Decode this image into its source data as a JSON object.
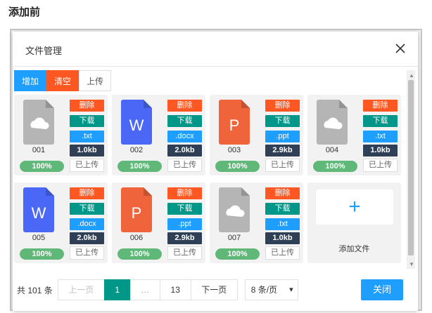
{
  "page_heading": "添加前",
  "dialog": {
    "title": "文件管理",
    "close_icon": "close-icon"
  },
  "toolbar": {
    "add_label": "增加",
    "clear_label": "清空",
    "upload_label": "上传"
  },
  "colors": {
    "blue": "#1e9fff",
    "orange": "#ff5722",
    "teal": "#009688",
    "navy": "#2f4056",
    "green": "#5fb878",
    "word_blue": "#4a68f5",
    "ppt_orange": "#f0643c",
    "generic_gray": "#b5b5b5"
  },
  "labels": {
    "delete": "删除",
    "download": "下载"
  },
  "files": [
    {
      "name": "001",
      "ext": ".txt",
      "size": "1.0kb",
      "progress": 100,
      "progress_text": "100%",
      "status": "已上传",
      "icon": "cloud-file-icon",
      "icon_letter": ""
    },
    {
      "name": "002",
      "ext": ".docx",
      "size": "2.0kb",
      "progress": 100,
      "progress_text": "100%",
      "status": "已上传",
      "icon": "word-file-icon",
      "icon_letter": "W"
    },
    {
      "name": "003",
      "ext": ".ppt",
      "size": "2.9kb",
      "progress": 100,
      "progress_text": "100%",
      "status": "已上传",
      "icon": "ppt-file-icon",
      "icon_letter": "P"
    },
    {
      "name": "004",
      "ext": ".txt",
      "size": "1.0kb",
      "progress": 100,
      "progress_text": "100%",
      "status": "已上传",
      "icon": "cloud-file-icon",
      "icon_letter": ""
    },
    {
      "name": "005",
      "ext": ".docx",
      "size": "2.0kb",
      "progress": 100,
      "progress_text": "100%",
      "status": "已上传",
      "icon": "word-file-icon",
      "icon_letter": "W"
    },
    {
      "name": "006",
      "ext": ".ppt",
      "size": "2.9kb",
      "progress": 100,
      "progress_text": "100%",
      "status": "已上传",
      "icon": "ppt-file-icon",
      "icon_letter": "P"
    },
    {
      "name": "007",
      "ext": ".txt",
      "size": "1.0kb",
      "progress": 100,
      "progress_text": "100%",
      "status": "已上传",
      "icon": "cloud-file-icon",
      "icon_letter": ""
    }
  ],
  "add_card": {
    "label": "添加文件",
    "plus": "+"
  },
  "pagination": {
    "total": "共 101 条",
    "prev": "上一页",
    "current": "1",
    "ellipsis": "…",
    "last": "13",
    "next": "下一页",
    "page_size": "8 条/页"
  },
  "close_button": "关闭"
}
